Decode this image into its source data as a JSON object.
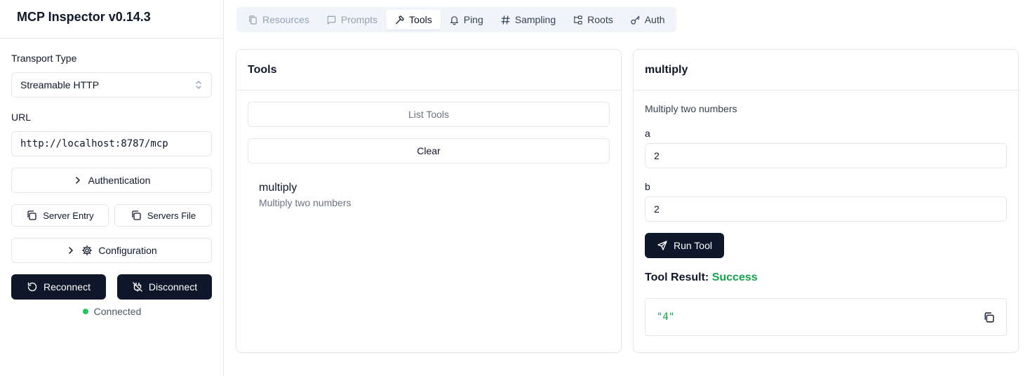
{
  "app": {
    "title": "MCP Inspector v0.14.3"
  },
  "sidebar": {
    "transport_label": "Transport Type",
    "transport_value": "Streamable HTTP",
    "url_label": "URL",
    "url_value": "http://localhost:8787/mcp",
    "authentication_label": "Authentication",
    "server_entry_label": "Server Entry",
    "servers_file_label": "Servers File",
    "configuration_label": "Configuration",
    "reconnect_label": "Reconnect",
    "disconnect_label": "Disconnect",
    "status_text": "Connected",
    "status_color": "#22c55e"
  },
  "tabs": [
    {
      "label": "Resources",
      "icon": "files-icon",
      "state": "disabled"
    },
    {
      "label": "Prompts",
      "icon": "message-square-icon",
      "state": "disabled"
    },
    {
      "label": "Tools",
      "icon": "hammer-icon",
      "state": "active"
    },
    {
      "label": "Ping",
      "icon": "bell-icon",
      "state": "normal"
    },
    {
      "label": "Sampling",
      "icon": "hash-icon",
      "state": "normal"
    },
    {
      "label": "Roots",
      "icon": "folder-tree-icon",
      "state": "normal"
    },
    {
      "label": "Auth",
      "icon": "key-icon",
      "state": "normal"
    }
  ],
  "tools_panel": {
    "title": "Tools",
    "list_button": "List Tools",
    "clear_button": "Clear",
    "items": [
      {
        "name": "multiply",
        "description": "Multiply two numbers"
      }
    ]
  },
  "detail_panel": {
    "title": "multiply",
    "description": "Multiply two numbers",
    "params": [
      {
        "label": "a",
        "value": "2"
      },
      {
        "label": "b",
        "value": "2"
      }
    ],
    "run_button": "Run Tool",
    "result_label": "Tool Result:",
    "result_status": "Success",
    "result_value": "\"4\"",
    "success_color": "#16a34a"
  }
}
